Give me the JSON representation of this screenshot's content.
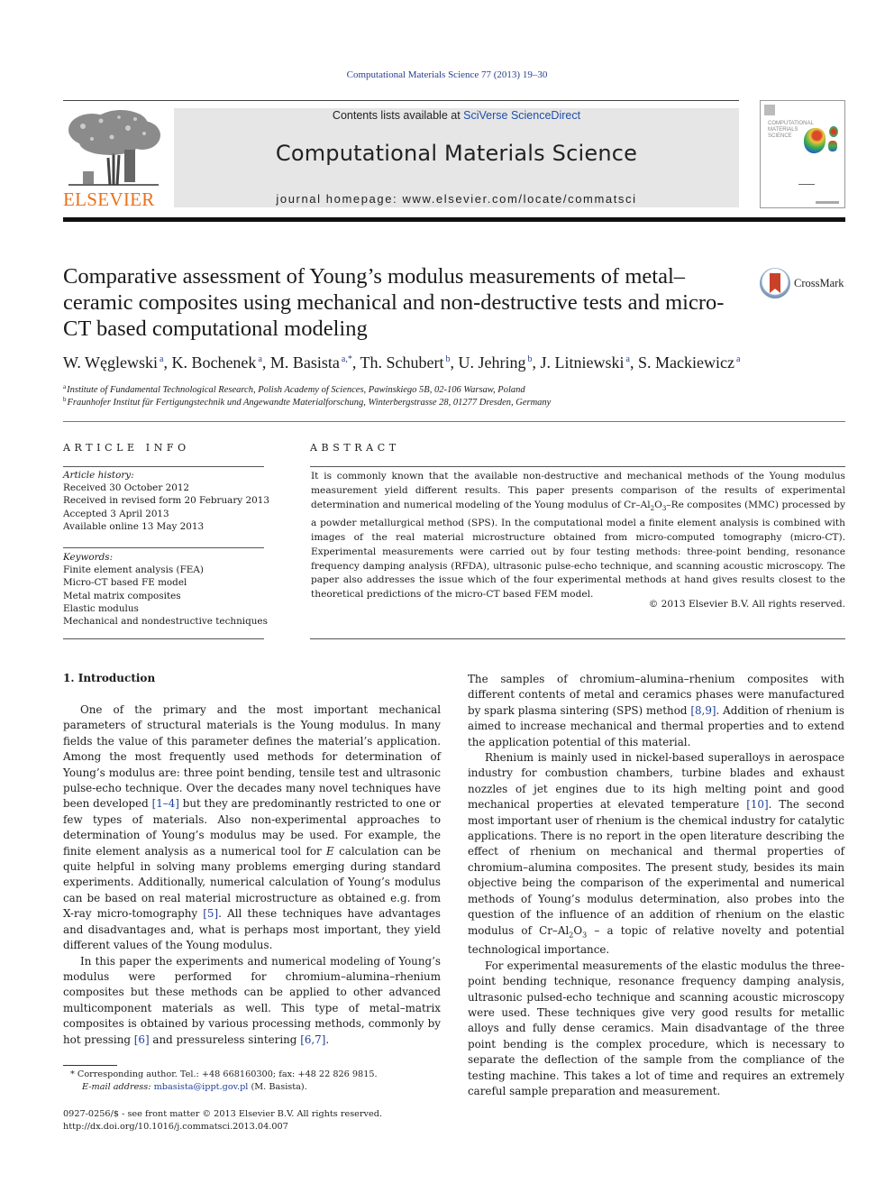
{
  "header": {
    "journal_ref": "Computational Materials Science 77 (2013) 19–30",
    "contents_prefix": "Contents lists available at ",
    "contents_link": "SciVerse ScienceDirect",
    "journal_name": "Computational Materials Science",
    "homepage": "journal homepage: www.elsevier.com/locate/commatsci",
    "publisher_logo_text": "ELSEVIER",
    "cover_title": "COMPUTATIONAL MATERIALS SCIENCE",
    "crossmark_label": "CrossMark"
  },
  "article": {
    "title": "Comparative assessment of Young’s modulus measurements of metal–ceramic composites using mechanical and non-destructive tests and micro-CT based computational modeling",
    "authors": [
      {
        "name": "W. Węglewski",
        "aff": "a"
      },
      {
        "name": "K. Bochenek",
        "aff": "a"
      },
      {
        "name": "M. Basista",
        "aff": "a,*"
      },
      {
        "name": "Th. Schubert",
        "aff": "b"
      },
      {
        "name": "U. Jehring",
        "aff": "b"
      },
      {
        "name": "J. Litniewski",
        "aff": "a"
      },
      {
        "name": "S. Mackiewicz",
        "aff": "a"
      }
    ],
    "affiliations": [
      {
        "mark": "a",
        "text": "Institute of Fundamental Technological Research, Polish Academy of Sciences, Pawinskiego 5B, 02-106 Warsaw, Poland"
      },
      {
        "mark": "b",
        "text": "Fraunhofer Institut für Fertigungstechnik und Angewandte Materialforschung, Winterbergstrasse 28, 01277 Dresden, Germany"
      }
    ]
  },
  "article_info": {
    "heading": "ARTICLE INFO",
    "history_label": "Article history:",
    "history": [
      "Received 30 October 2012",
      "Received in revised form 20 February 2013",
      "Accepted 3 April 2013",
      "Available online 13 May 2013"
    ],
    "keywords_label": "Keywords:",
    "keywords": [
      "Finite element analysis (FEA)",
      "Micro-CT based FE model",
      "Metal matrix composites",
      "Elastic modulus",
      "Mechanical and nondestructive techniques"
    ]
  },
  "abstract": {
    "heading": "ABSTRACT",
    "text_1": "It is commonly known that the available non-destructive and mechanical methods of the Young modulus measurement yield different results. This paper presents comparison of the results of experimental determination and numerical modeling of the Young modulus of Cr–Al",
    "sub_1": "2",
    "text_2": "O",
    "sub_2": "3",
    "text_3": "–Re composites (MMC) processed by a powder metallurgical method (SPS). In the computational model a finite element analysis is combined with images of the real material microstructure obtained from micro-computed tomography (micro-CT). Experimental measurements were carried out by four testing methods: three-point bending, resonance frequency damping analysis (RFDA), ultrasonic pulse-echo technique, and scanning acoustic microscopy. The paper also addresses the issue which of the four experimental methods at hand gives results closest to the theoretical predictions of the micro-CT based FEM model.",
    "copyright": "© 2013 Elsevier B.V. All rights reserved."
  },
  "body": {
    "section_heading": "1. Introduction",
    "left_p1_a": "One of the primary and the most important mechanical parameters of structural materials is the Young modulus. In many fields the value of this parameter defines the material’s application. Among the most frequently used methods for determination of Young’s modulus are: three point bending, tensile test and ultrasonic pulse-echo technique. Over the decades many novel techniques have been developed ",
    "ref_1_4": "[1–4]",
    "left_p1_b": " but they are predominantly restricted to one or few types of materials. Also non-experimental approaches to determination of Young’s modulus may be used. For example, the finite element analysis as a numerical tool for ",
    "e_symbol": "E",
    "left_p1_c": " calculation can be quite helpful in solving many problems emerging during standard experiments. Additionally, numerical calculation of Young’s modulus can be based on real material microstructure as obtained e.g. from X-ray micro-tomography ",
    "ref_5": "[5]",
    "left_p1_d": ". All these techniques have advantages and disadvantages and, what is perhaps most important, they yield different values of the Young modulus.",
    "left_p2_a": "In this paper the experiments and numerical modeling of Young’s modulus were performed for chromium–alumina–rhenium composites but these methods can be applied to other advanced multicomponent materials as well. This type of metal–matrix composites is obtained by various processing methods, commonly by hot pressing ",
    "ref_6": "[6]",
    "left_p2_b": " and pressureless sintering ",
    "ref_6_7": "[6,7]",
    "left_p2_c": ".",
    "right_p1_a": "The samples of chromium–alumina–rhenium composites with different contents of metal and ceramics phases were manufactured by spark plasma sintering (SPS) method ",
    "ref_8_9": "[8,9]",
    "right_p1_b": ". Addition of rhenium is aimed to increase mechanical and thermal properties and to extend the application potential of this material.",
    "right_p2_a": "Rhenium is mainly used in nickel-based superalloys in aerospace industry for combustion chambers, turbine blades and exhaust nozzles of jet engines due to its high melting point and good mechanical properties at elevated temperature ",
    "ref_10": "[10]",
    "right_p2_b": ". The second most important user of rhenium is the chemical industry for catalytic applications. There is no report in the open literature describing the effect of rhenium on mechanical and thermal properties of chromium–alumina composites. The present study, besides its main objective being the comparison of the experimental and numerical methods of Young’s modulus determination, also probes into the question of the influence of an addition of rhenium on the elastic modulus of Cr–Al",
    "right_p2_sub1": "2",
    "right_p2_c": "O",
    "right_p2_sub2": "3",
    "right_p2_d": " – a topic of relative novelty and potential technological importance.",
    "right_p3": "For experimental measurements of the elastic modulus the three-point bending technique, resonance frequency damping analysis, ultrasonic pulsed-echo technique and scanning acoustic microscopy were used. These techniques give very good results for metallic alloys and fully dense ceramics. Main disadvantage of the three point bending is the complex procedure, which is necessary to separate the deflection of the sample from the compliance of the testing machine. This takes a lot of time and requires an extremely careful sample preparation and measurement."
  },
  "footnotes": {
    "corresponding": "* Corresponding author. Tel.: +48 668160300; fax: +48 22 826 9815.",
    "email_label": "E-mail address:",
    "email": "mbasista@ippt.gov.pl",
    "email_suffix": " (M. Basista).",
    "issn": "0927-0256/$ - see front matter © 2013 Elsevier B.V. All rights reserved.",
    "doi": "http://dx.doi.org/10.1016/j.commatsci.2013.04.007"
  }
}
